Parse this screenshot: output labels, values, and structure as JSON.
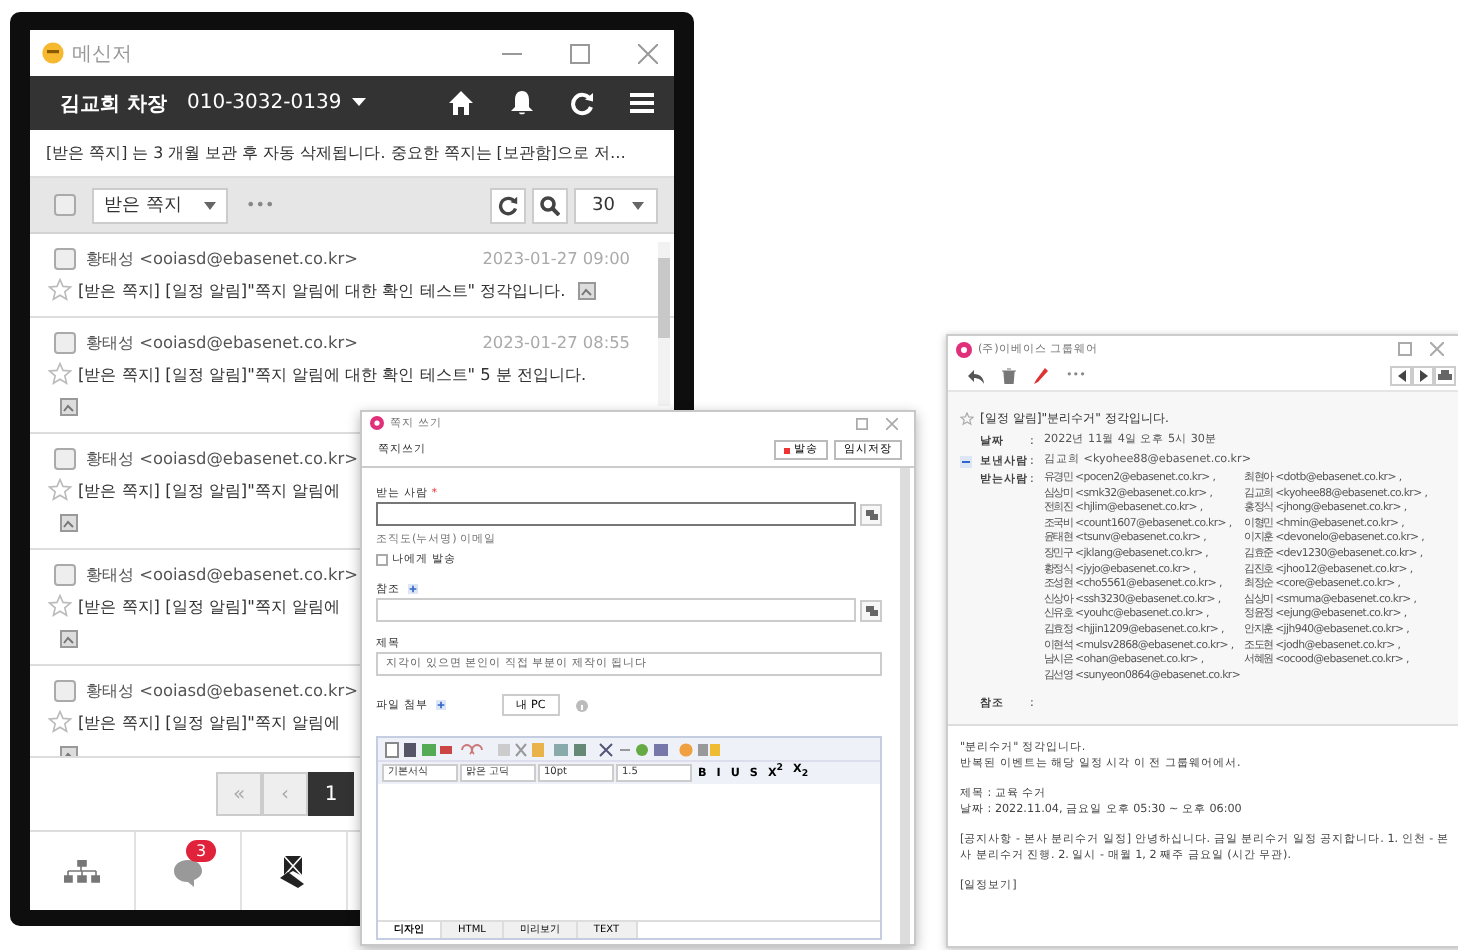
{
  "messenger": {
    "title": "메신저",
    "user_name": "김교희 차장",
    "phone": "010-3032-0139",
    "notice": "[받은 쪽지] 는 3 개월 보관 후 자동 삭제됩니다. 중요한 쪽지는 [보관함]으로 저…",
    "select_all_checked": false,
    "folder": "받은 쪽지",
    "more": "•••",
    "page_size": "30",
    "messages": [
      {
        "checked": false,
        "sender": "황태성 <ooiasd@ebasenet.co.kr>",
        "date": "2023-01-27 09:00",
        "subject": "[받은 쪽지] [일정 알림]\"쪽지 알림에 대한 확인 테스트\" 정각입니다.",
        "kind": "inline_attachment"
      },
      {
        "checked": false,
        "sender": "황태성 <ooiasd@ebasenet.co.kr>",
        "date": "2023-01-27 08:55",
        "subject": "[받은 쪽지] [일정 알림]\"쪽지 알림에 대한 확인 테스트\" 5 분 전입니다.",
        "kind": "wrapped_attachment"
      },
      {
        "checked": false,
        "sender": "황태성 <ooiasd@ebasenet.co.kr>",
        "subject": "[받은 쪽지] [일정 알림]\"쪽지 알림에",
        "kind": "wrapped_attachment"
      },
      {
        "checked": false,
        "sender": "황태성 <ooiasd@ebasenet.co.kr>",
        "subject": "[받은 쪽지] [일정 알림]\"쪽지 알림에",
        "kind": "wrapped_attachment"
      },
      {
        "checked": false,
        "sender": "황태성 <ooiasd@ebasenet.co.kr>",
        "subject": "[받은 쪽지] [일정 알림]\"쪽지 알림에",
        "kind": "wrapped_attachment"
      }
    ],
    "pagination": [
      {
        "label": "«",
        "selected": false
      },
      {
        "label": "‹",
        "selected": false
      },
      {
        "label": "1",
        "selected": true
      }
    ],
    "nav": [
      {
        "kind": "org"
      },
      {
        "kind": "chat",
        "badge": "3"
      },
      {
        "kind": "note"
      }
    ]
  },
  "compose": {
    "title": "쪽지 쓰기",
    "heading": "쪽지쓰기",
    "send": "발송",
    "save_draft": "임시저장",
    "to_label": "받는 사람",
    "required_mark": "*",
    "to_hint": "조직도(누서명) 이메일",
    "self_send": {
      "label": "나에게 발송",
      "checked": false
    },
    "cc_label": "참조",
    "subject_label": "제목",
    "subject_value": "지각이 있으면 본인이 직접 부분이 제작이 됩니다",
    "attach_label": "파일 첨부",
    "attach_button": "내 PC",
    "selects": [
      "기본서식",
      "맑은 고딕",
      "10pt",
      "1.5"
    ],
    "format_buttons": [
      "B",
      "I",
      "U",
      "S",
      "X$^{2}$",
      "X$_{2}$"
    ],
    "tabs": [
      {
        "label": "디자인",
        "selected": true
      },
      {
        "label": "HTML",
        "selected": false
      },
      {
        "label": "미리보기",
        "selected": false
      },
      {
        "label": "TEXT",
        "selected": false
      }
    ]
  },
  "viewer": {
    "title": "(주)이베이스 그룹웨어",
    "more": "•••",
    "subject": "[일정 알림]\"분리수거\" 정각입니다.",
    "fields": [
      {
        "label": "날짜",
        "sep": ":",
        "value": "2022년 11월 4일 오후 5시 30분"
      },
      {
        "label": "보낸사람",
        "sep": ":",
        "value": "김교희 <kyohee88@ebasenet.co.kr>",
        "expanded": true
      },
      {
        "label": "받는사람",
        "sep": ":",
        "values": [
          "유경민 <pocen2@ebasenet.co.kr> ,",
          "최현아 <dotb@ebasenet.co.kr> ,",
          "심상미 <smk32@ebasenet.co.kr> ,",
          "김교희 <kyohee88@ebasenet.co.kr> ,",
          "전희진 <hjlim@ebasenet.co.kr> ,",
          "홍정식 <jhong@ebasenet.co.kr> ,",
          "조국비 <count1607@ebasenet.co.kr> ,",
          "이형민 <hmin@ebasenet.co.kr> ,",
          "윤태현 <tsunv@ebasenet.co.kr> ,",
          "이지훈 <devonelo@ebasenet.co.kr> ,",
          "장민구 <jklang@ebasenet.co.kr> ,",
          "김효준 <dev1230@ebasenet.co.kr> ,",
          "황정식 <jyjo@ebasenet.co.kr> ,",
          "김진호 <jhoo12@ebasenet.co.kr> ,",
          "조성현 <cho5561@ebasenet.co.kr> ,",
          "최정순 <core@ebasenet.co.kr> ,",
          "신상아 <ssh3230@ebasenet.co.kr> ,",
          "심상미 <smuma@ebasenet.co.kr> ,",
          "신유호 <youhc@ebasenet.co.kr> ,",
          "정윤정 <ejung@ebasenet.co.kr> ,",
          "김효정 <hjjin1209@ebasenet.co.kr> ,",
          "안지훈 <jjh940@ebasenet.co.kr> ,",
          "이현석 <mulsv2868@ebasenet.co.kr> ,",
          "조도현 <jodh@ebasenet.co.kr> ,",
          "남시은 <ohan@ebasenet.co.kr> ,",
          "서혜원 <ocood@ebasenet.co.kr> ,",
          "김선영 <sunyeon0864@ebasenet.co.kr>"
        ]
      },
      {
        "label": "참조",
        "sep": ":"
      }
    ],
    "body": [
      [
        "\"분리수거\" 정각입니다.",
        "반복된 이벤트는 해당 일정 시각 이 전 그룹웨어에서."
      ],
      [
        "제목 : 교육 수거",
        "날짜 : 2022.11.04, 금요일 오후 05:30 ~ 오후 06:00"
      ],
      [
        "[공지사항 - 본사 분리수거 일정] 안녕하십니다. 금일 분리수거 일정 공지합니다. 1. 인천 - 본사 분리수거 진행. 2. 일시 - 매월 1, 2 째주 금요일 (시간 무관)."
      ],
      [
        "[일정보기]"
      ]
    ]
  }
}
